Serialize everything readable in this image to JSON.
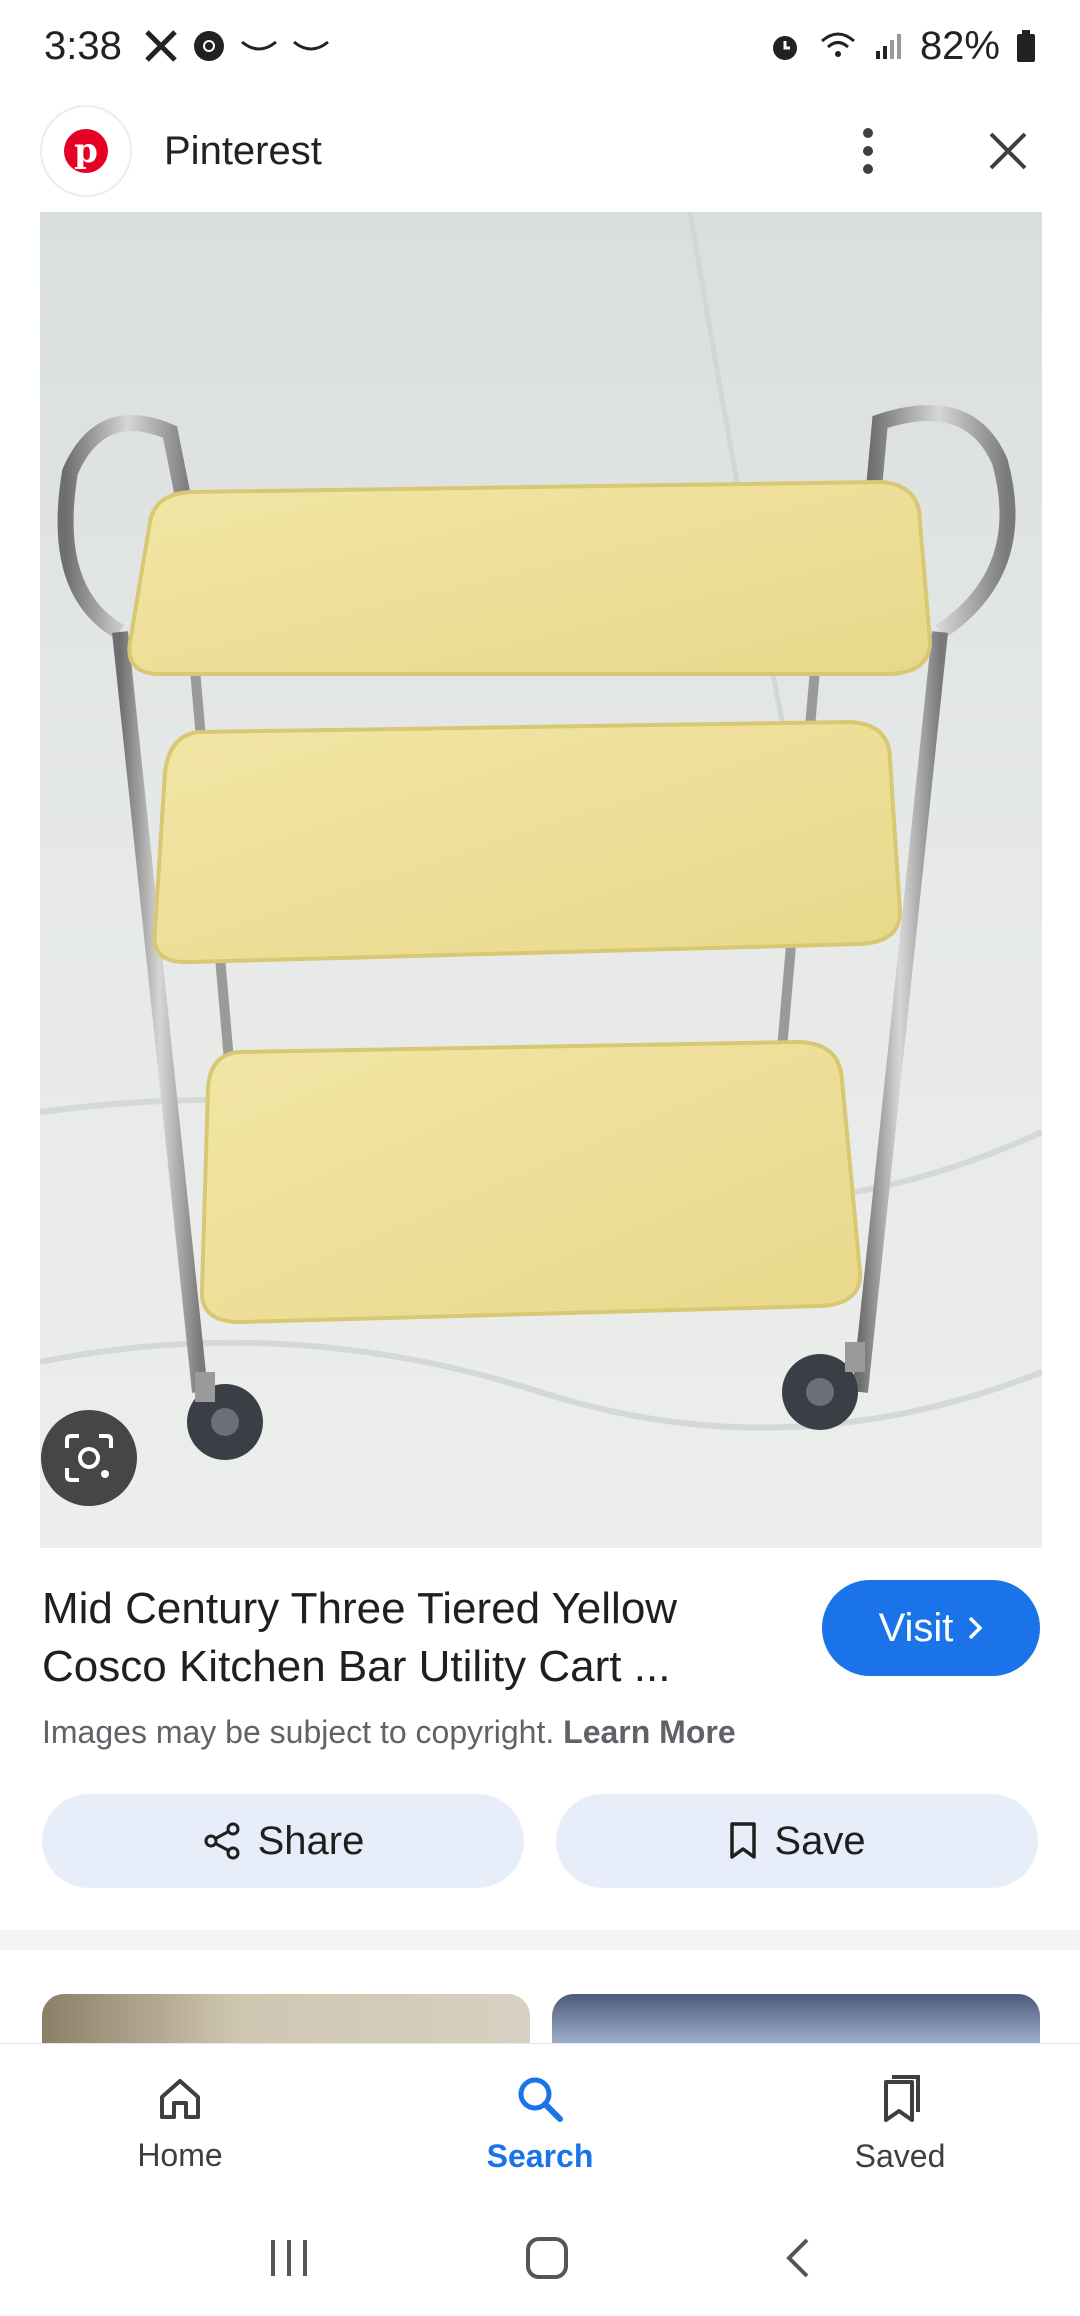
{
  "status_bar": {
    "time": "3:38",
    "left_icons": [
      "x-icon",
      "chrome-icon",
      "voicemail-icon",
      "voicemail-icon"
    ],
    "right_icons": [
      "alarm-icon",
      "wifi-icon",
      "signal-icon"
    ],
    "battery": "82%"
  },
  "app_bar": {
    "site_name": "Pinterest",
    "logo_letter": "p",
    "brand_color": "#e60023"
  },
  "preview": {
    "lens_icon": "google-lens-icon"
  },
  "result": {
    "title": "Mid Century Three Tiered Yellow Cosco Kitchen Bar Utility Cart ...",
    "visit_label": "Visit",
    "copyright_text": "Images may be subject to copyright.",
    "learn_more_label": "Learn More",
    "accent_color": "#1a73e8"
  },
  "actions": {
    "share_label": "Share",
    "save_label": "Save"
  },
  "bottom_nav": {
    "items": [
      {
        "label": "Home",
        "icon": "home-icon",
        "active": false
      },
      {
        "label": "Search",
        "icon": "search-icon",
        "active": true
      },
      {
        "label": "Saved",
        "icon": "saved-icon",
        "active": false
      }
    ]
  },
  "system_nav": [
    "recents-icon",
    "home-button-icon",
    "back-icon"
  ]
}
